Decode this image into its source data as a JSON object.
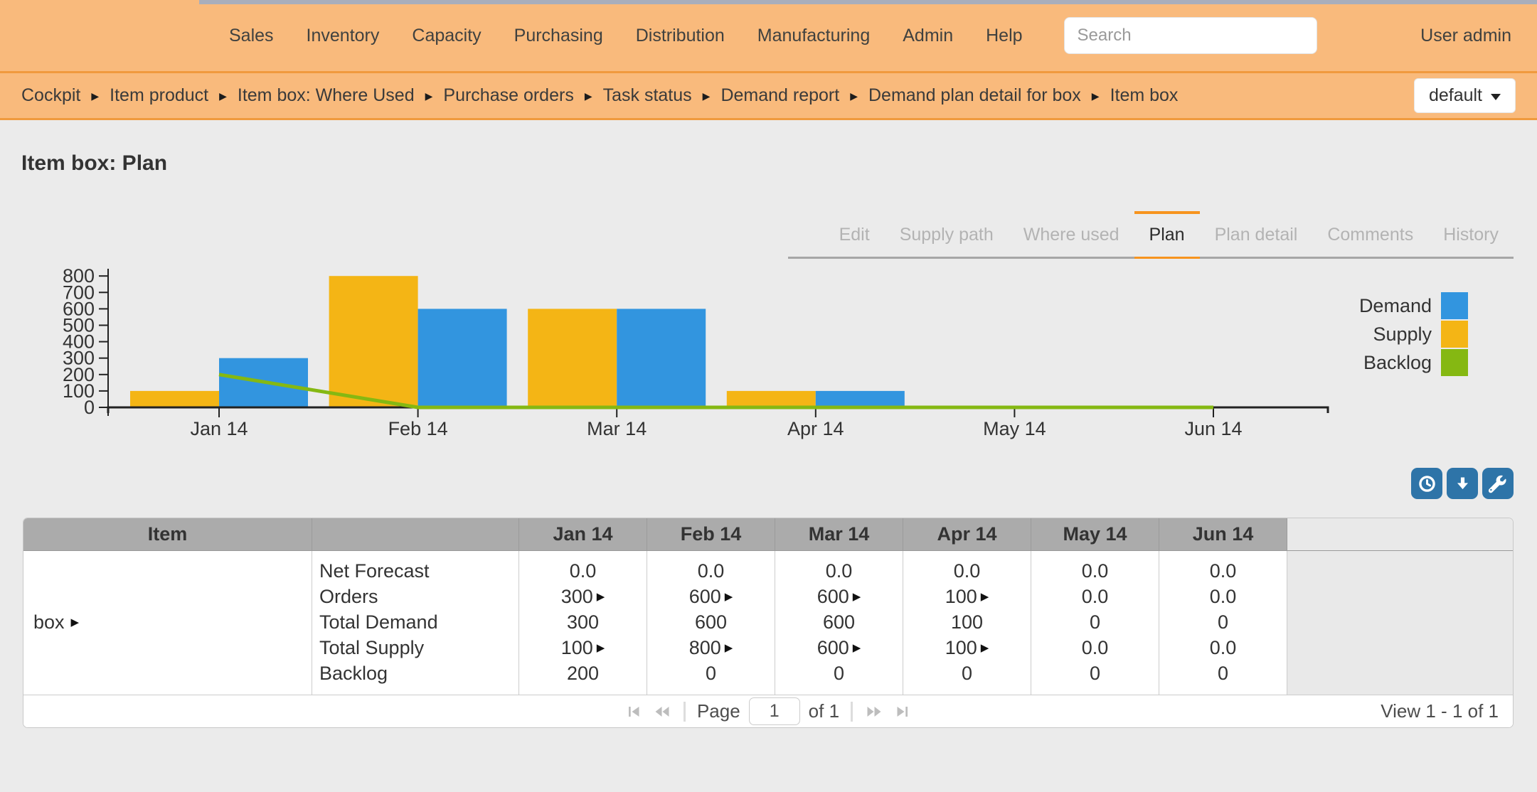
{
  "nav": {
    "items": [
      "Sales",
      "Inventory",
      "Capacity",
      "Purchasing",
      "Distribution",
      "Manufacturing",
      "Admin",
      "Help"
    ],
    "search_placeholder": "Search",
    "user": "User admin"
  },
  "breadcrumb": {
    "items": [
      "Cockpit",
      "Item product",
      "Item box: Where Used",
      "Purchase orders",
      "Task status",
      "Demand report",
      "Demand plan detail for box",
      "Item box"
    ],
    "view_selector": "default"
  },
  "page": {
    "title": "Item box: Plan"
  },
  "tabs": {
    "items": [
      "Edit",
      "Supply path",
      "Where used",
      "Plan",
      "Plan detail",
      "Comments",
      "History"
    ],
    "active": "Plan"
  },
  "chart_data": {
    "type": "bar",
    "categories": [
      "Jan 14",
      "Feb 14",
      "Mar 14",
      "Apr 14",
      "May 14",
      "Jun 14"
    ],
    "series": [
      {
        "name": "Supply",
        "type": "bar",
        "color": "#f4b515",
        "values": [
          100,
          800,
          600,
          100,
          0,
          0
        ]
      },
      {
        "name": "Demand",
        "type": "bar",
        "color": "#3295df",
        "values": [
          300,
          600,
          600,
          100,
          0,
          0
        ]
      },
      {
        "name": "Backlog",
        "type": "line",
        "color": "#85b812",
        "values": [
          200,
          0,
          0,
          0,
          0,
          0
        ]
      }
    ],
    "ylim": [
      0,
      800
    ],
    "yticks": [
      0,
      100,
      200,
      300,
      400,
      500,
      600,
      700,
      800
    ],
    "legend_order": [
      "Demand",
      "Supply",
      "Backlog"
    ],
    "legend_position": "right",
    "grid": false
  },
  "toolbar": {
    "buttons": [
      {
        "icon": "clock-icon"
      },
      {
        "icon": "download-arrow-icon"
      },
      {
        "icon": "wrench-icon"
      }
    ]
  },
  "table": {
    "columns": [
      "Item",
      "",
      "Jan 14",
      "Feb 14",
      "Mar 14",
      "Apr 14",
      "May 14",
      "Jun 14"
    ],
    "item": {
      "label": "box"
    },
    "rows": [
      {
        "label": "Net Forecast",
        "values": [
          "0.0",
          "0.0",
          "0.0",
          "0.0",
          "0.0",
          "0.0"
        ],
        "drill": [
          false,
          false,
          false,
          false,
          false,
          false
        ]
      },
      {
        "label": "Orders",
        "values": [
          "300",
          "600",
          "600",
          "100",
          "0.0",
          "0.0"
        ],
        "drill": [
          true,
          true,
          true,
          true,
          false,
          false
        ]
      },
      {
        "label": "Total Demand",
        "values": [
          "300",
          "600",
          "600",
          "100",
          "0",
          "0"
        ],
        "drill": [
          false,
          false,
          false,
          false,
          false,
          false
        ]
      },
      {
        "label": "Total Supply",
        "values": [
          "100",
          "800",
          "600",
          "100",
          "0.0",
          "0.0"
        ],
        "drill": [
          true,
          true,
          true,
          true,
          false,
          false
        ]
      },
      {
        "label": "Backlog",
        "values": [
          "200",
          "0",
          "0",
          "0",
          "0",
          "0"
        ],
        "drill": [
          false,
          false,
          false,
          false,
          false,
          false
        ]
      }
    ],
    "pager": {
      "page_label": "Page",
      "page_value": "1",
      "of_label": "of 1",
      "view_status": "View 1 - 1 of 1"
    }
  },
  "colors": {
    "accent_orange": "#f7941e",
    "topbar_bg": "#f9ba7c",
    "topbar_border": "#f09a3e",
    "page_bg": "#ebebeb",
    "button_blue": "#2e74a8",
    "grid_header_bg": "#ababab"
  }
}
